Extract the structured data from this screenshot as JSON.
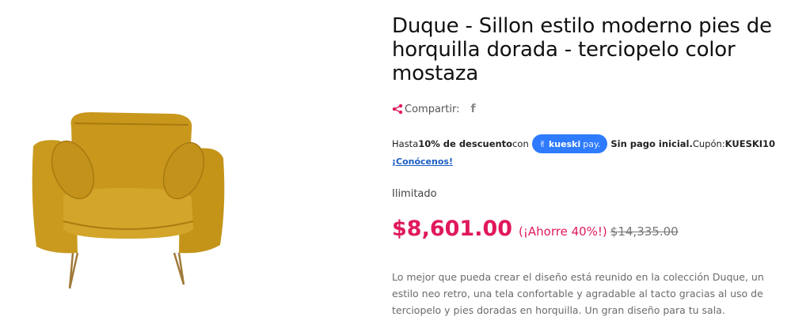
{
  "product": {
    "title": "Duque - Sillon estilo moderno pies de horquilla dorada - terciopelo color mostaza",
    "image_alt": "Sillón mostaza de terciopelo con patas de horquilla doradas"
  },
  "share": {
    "label": "Compartir:",
    "facebook_glyph": "f"
  },
  "financing": {
    "prefix": "Hasta ",
    "discount": "10% de descuento",
    "connector": " con",
    "brand_main": "kueski",
    "brand_suffix": "pay.",
    "no_down": "Sin pago inicial.",
    "coupon_label": " Cupón: ",
    "coupon_code": "KUESKI10",
    "link": "¡Conócenos!"
  },
  "availability": "Ilimitado",
  "pricing": {
    "current": "$8,601.00",
    "savings": "(¡Ahorre 40%!)",
    "original": "$14,335.00"
  },
  "description": "Lo mejor que pueda crear el diseño está reunido en la colección Duque, un estilo neo retro, una tela confortable y agradable al tacto gracias al uso de terciopelo y pies doradas en horquilla. Un gran diseño para tu sala.",
  "colors": {
    "price": "#e0195c",
    "kueski_blue": "#2f7bff",
    "mustard": "#c99a1e"
  }
}
